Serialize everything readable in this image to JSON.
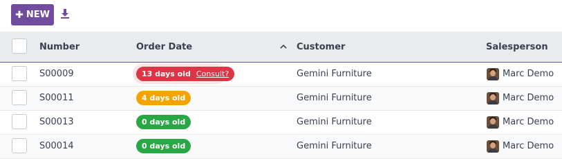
{
  "toolbar": {
    "new_label": "NEW",
    "new_icon": "plus-icon",
    "download_icon": "download-icon",
    "accent": "#714b9e"
  },
  "columns": {
    "number": "Number",
    "order_date": "Order Date",
    "customer": "Customer",
    "salesperson": "Salesperson",
    "sort_icon": "chevron-up-icon"
  },
  "rows": [
    {
      "number": "S00009",
      "badge": "13 days old",
      "badge_color": "#dc3545",
      "action": "Consult?",
      "customer": "Gemini Furniture",
      "salesperson": "Marc Demo"
    },
    {
      "number": "S00011",
      "badge": "4 days old",
      "badge_color": "#f5a300",
      "action": "",
      "customer": "Gemini Furniture",
      "salesperson": "Marc Demo"
    },
    {
      "number": "S00013",
      "badge": "0 days old",
      "badge_color": "#28a745",
      "action": "",
      "customer": "Gemini Furniture",
      "salesperson": "Marc Demo"
    },
    {
      "number": "S00014",
      "badge": "0 days old",
      "badge_color": "#28a745",
      "action": "",
      "customer": "Gemini Furniture",
      "salesperson": "Marc Demo"
    }
  ]
}
